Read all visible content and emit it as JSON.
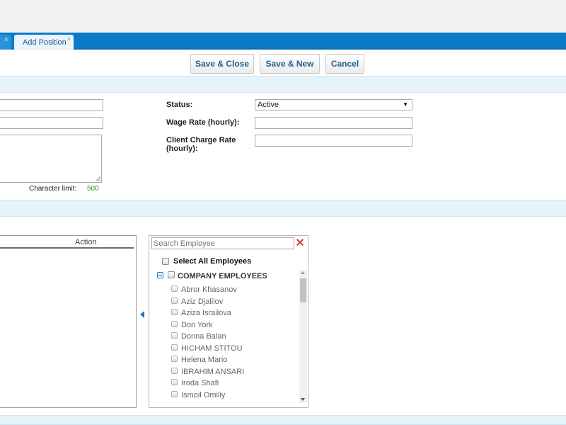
{
  "tabs": [
    {
      "label": "",
      "close_glyph": "×"
    },
    {
      "label": "Add Position",
      "close_glyph": "×"
    }
  ],
  "toolbar": {
    "save_close_label": "Save & Close",
    "save_new_label": "Save & New",
    "cancel_label": "Cancel"
  },
  "form": {
    "character_limit_label": "Character limit:",
    "character_limit_value": "500",
    "status_label": "Status:",
    "status_value": "Active",
    "wage_rate_label": "Wage Rate (hourly):",
    "client_charge_rate_label": "Client Charge Rate (hourly):"
  },
  "assigned_grid": {
    "action_header": "Action"
  },
  "employee_picker": {
    "search_placeholder": "Search Employee",
    "select_all_label": "Select All Employees",
    "group_label": "COMPANY EMPLOYEES",
    "employees": [
      "Abror Khasanov",
      "Aziz Djalilov",
      "Aziza Israilova",
      "Don York",
      "Donna Balan",
      "HICHAM STITOU",
      "Helena Mario",
      "IBRAHIM ANSARI",
      "Iroda Shafi",
      "Ismoil Omiliy"
    ]
  },
  "colors": {
    "tab_bar": "#0a7cc7",
    "section_band": "#e7f3fb",
    "button_text": "#1e5f91",
    "char_limit_value": "#2e8b2e",
    "clear_icon": "#e03a2a"
  }
}
